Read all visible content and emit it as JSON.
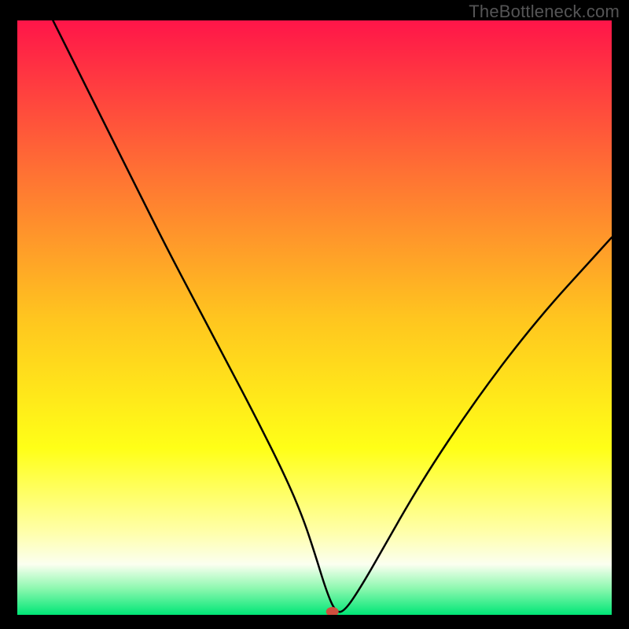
{
  "watermark": "TheBottleneck.com",
  "chart_data": {
    "type": "line",
    "title": "",
    "xlabel": "",
    "ylabel": "",
    "xlim": [
      0,
      100
    ],
    "ylim": [
      0,
      100
    ],
    "background_gradient": {
      "stops": [
        {
          "offset": 0.0,
          "color": "#ff1549"
        },
        {
          "offset": 0.25,
          "color": "#ff6f34"
        },
        {
          "offset": 0.5,
          "color": "#ffc51f"
        },
        {
          "offset": 0.72,
          "color": "#ffff17"
        },
        {
          "offset": 0.86,
          "color": "#ffffa9"
        },
        {
          "offset": 0.915,
          "color": "#fbfff0"
        },
        {
          "offset": 0.955,
          "color": "#8ef8b0"
        },
        {
          "offset": 1.0,
          "color": "#00e676"
        }
      ]
    },
    "series": [
      {
        "name": "bottleneck-curve",
        "color": "#000000",
        "x": [
          6.0,
          10.0,
          15.0,
          20.0,
          25.0,
          30.0,
          35.0,
          40.0,
          45.0,
          48.0,
          50.0,
          52.0,
          53.5,
          55.0,
          58.0,
          62.0,
          66.0,
          70.0,
          75.0,
          80.0,
          85.0,
          90.0,
          95.0,
          100.0
        ],
        "y": [
          100.0,
          92.0,
          82.0,
          72.0,
          62.0,
          52.5,
          43.0,
          33.5,
          23.5,
          16.5,
          10.5,
          4.0,
          0.5,
          0.5,
          5.0,
          12.0,
          19.0,
          25.5,
          33.0,
          40.0,
          46.5,
          52.5,
          58.0,
          63.5
        ]
      }
    ],
    "marker": {
      "name": "target-marker",
      "x": 53.0,
      "y": 0.0,
      "color": "#cf4f3f",
      "rx": 8,
      "ry": 6
    }
  }
}
